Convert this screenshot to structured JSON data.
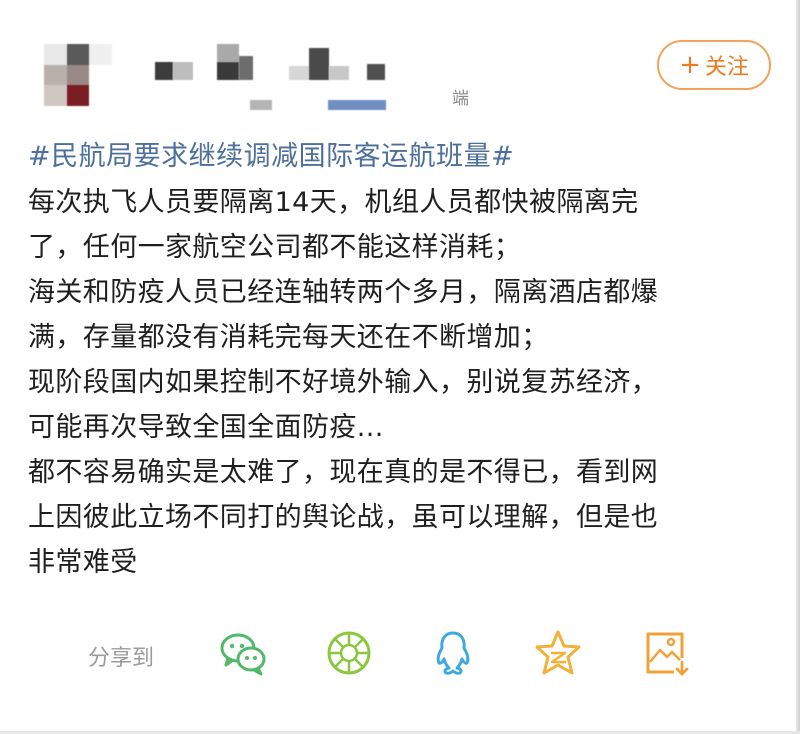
{
  "header": {
    "source_suffix": "端"
  },
  "follow": {
    "plus": "+",
    "label": "关注",
    "color": "#ee7a22",
    "border_color": "#f2a25a"
  },
  "post": {
    "hashtag": "#民航局要求继续调减国际客运航班量#",
    "lines": [
      "每次执飞人员要隔离14天，机组人员都快被隔离完",
      "了，任何一家航空公司都不能这样消耗；",
      "海关和防疫人员已经连轴转两个多月，隔离酒店都爆",
      "满，存量都没有消耗完每天还在不断增加；",
      "现阶段国内如果控制不好境外输入，别说复苏经济，",
      "可能再次导致全国全面防疫...",
      "都不容易确实是太难了，现在真的是不得已，看到网",
      "上因彼此立场不同打的舆论战，虽可以理解，但是也",
      "非常难受"
    ]
  },
  "share": {
    "label": "分享到",
    "icons": [
      "wechat-icon",
      "moments-icon",
      "qq-icon",
      "qzone-icon",
      "save-image-icon"
    ],
    "colors": {
      "wechat": "#52b86a",
      "moments": "#8cc63f",
      "qq": "#3ea8e0",
      "qzone": "#f3b13a",
      "save": "#f0a13a"
    }
  }
}
